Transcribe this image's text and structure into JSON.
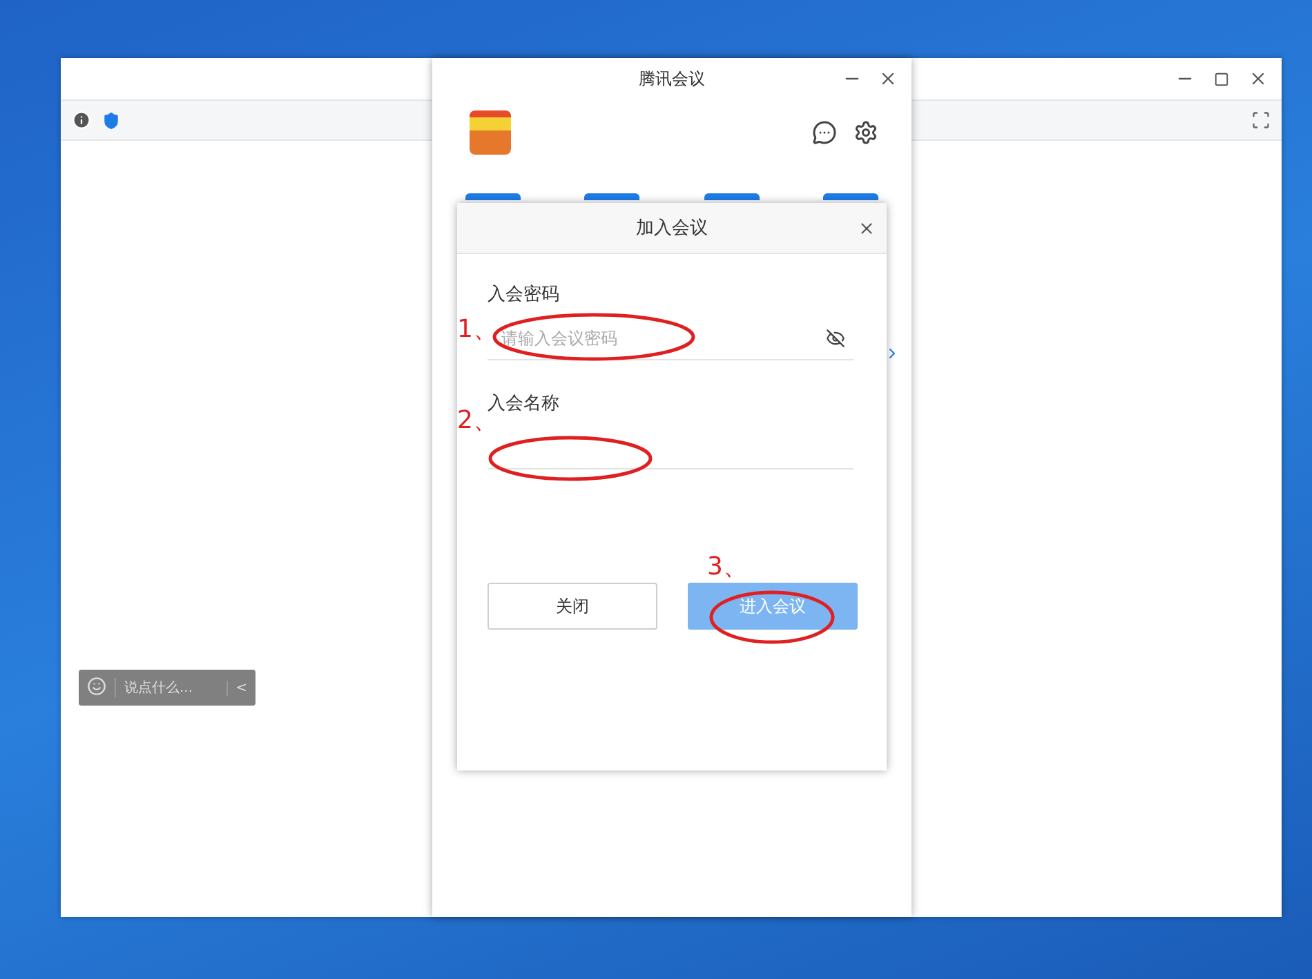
{
  "background_window": {
    "chat_bar": {
      "placeholder": "说点什么...",
      "collapse": "<"
    }
  },
  "app_window": {
    "title": "腾讯会议"
  },
  "dialog": {
    "title": "加入会议",
    "fields": [
      {
        "label": "入会密码",
        "placeholder": "请输入会议密码",
        "kind": "password"
      },
      {
        "label": "入会名称",
        "kind": "text"
      }
    ],
    "buttons": [
      {
        "label": "关闭",
        "kind": "secondary"
      },
      {
        "label": "进入会议",
        "kind": "primary"
      }
    ]
  },
  "annotations": [
    {
      "label": "1、"
    },
    {
      "label": "2、"
    },
    {
      "label": "3、"
    }
  ]
}
